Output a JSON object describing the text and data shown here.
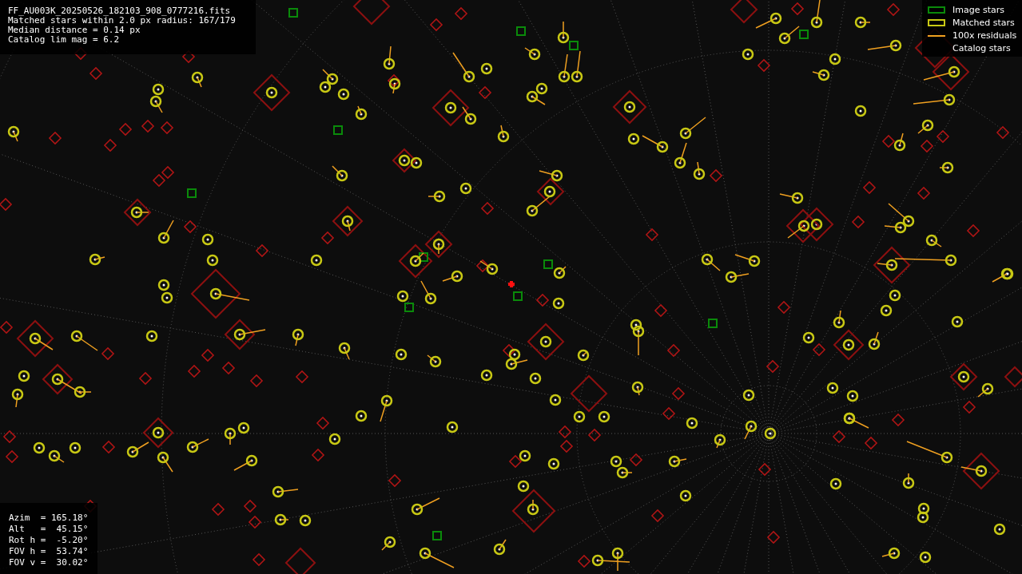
{
  "info": {
    "lines": [
      "FF_AU003K_20250526_182103_908_0777216.fits",
      "Matched stars within 2.0 px radius: 167/179",
      "Median distance = 0.14 px",
      "Catalog lim mag = 6.2"
    ]
  },
  "legend": [
    {
      "kind": "image",
      "label": "Image stars"
    },
    {
      "kind": "matched",
      "label": "Matched stars"
    },
    {
      "kind": "residual",
      "label": "100x residuals"
    },
    {
      "kind": "catalog",
      "label": "Catalog stars"
    }
  ],
  "pointing": {
    "lines": [
      "Azim  = 165.18°",
      "Alt   =  45.15°",
      "Rot h =  -5.20°",
      "FOV h =  53.74°",
      "FOV v =  30.02°"
    ]
  }
}
